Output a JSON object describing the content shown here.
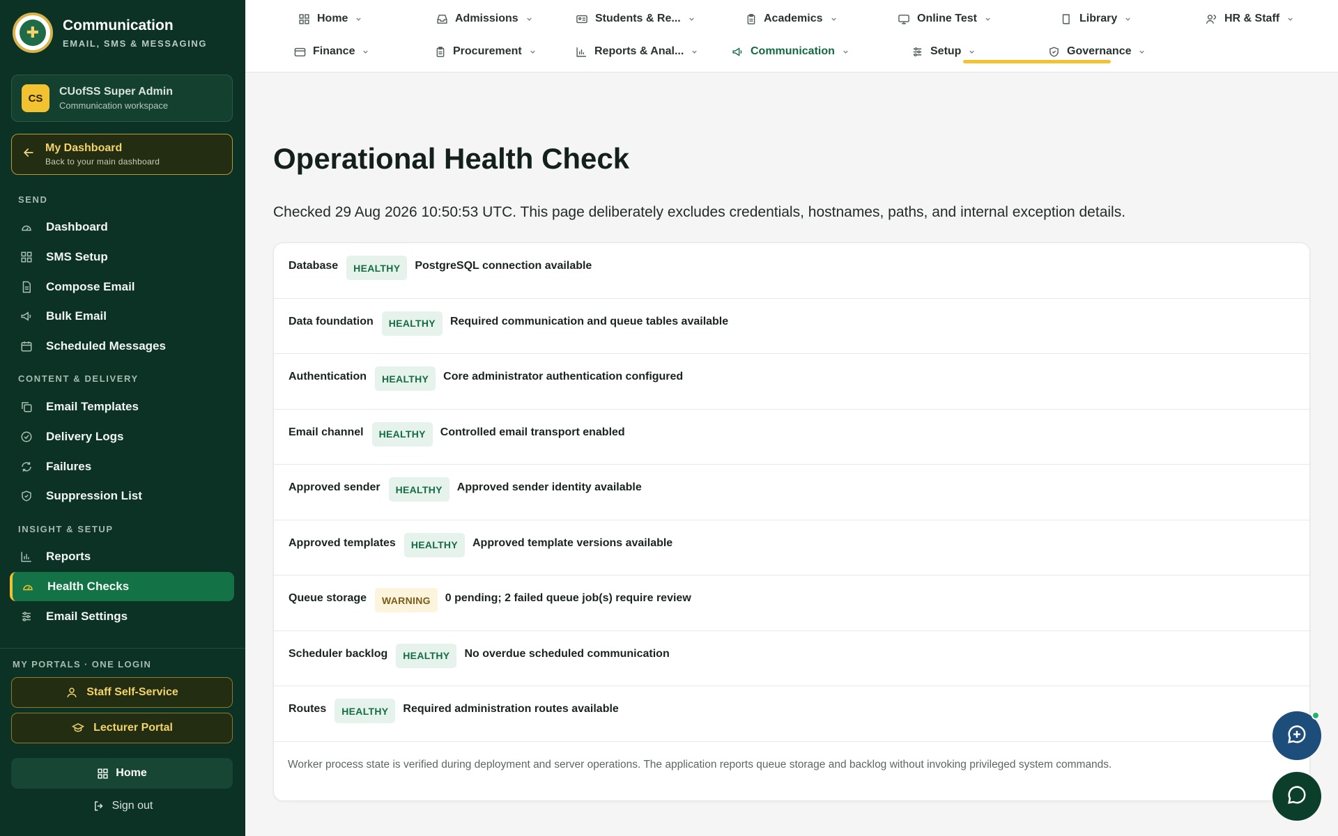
{
  "brand": {
    "title": "Communication",
    "subtitle": "EMAIL, SMS & MESSAGING"
  },
  "user": {
    "initials": "CS",
    "name": "CUofSS Super Admin",
    "workspace": "Communication workspace"
  },
  "dashboard_link": {
    "title": "My Dashboard",
    "subtitle": "Back to your main dashboard"
  },
  "sidebar": {
    "sections": [
      {
        "label": "SEND",
        "items": [
          "Dashboard",
          "SMS Setup",
          "Compose Email",
          "Bulk Email",
          "Scheduled Messages"
        ]
      },
      {
        "label": "CONTENT & DELIVERY",
        "items": [
          "Email Templates",
          "Delivery Logs",
          "Failures",
          "Suppression List"
        ]
      },
      {
        "label": "INSIGHT & SETUP",
        "items": [
          "Reports",
          "Health Checks",
          "Email Settings"
        ]
      }
    ],
    "active_item": "Health Checks",
    "portals_label": "MY PORTALS · ONE LOGIN",
    "portals": [
      "Staff Self-Service",
      "Lecturer Portal"
    ],
    "home_label": "Home",
    "signout_label": "Sign out"
  },
  "topnav": {
    "row1": [
      "Home",
      "Admissions",
      "Students & Re...",
      "Academics",
      "Online Test",
      "Library",
      "HR & Staff"
    ],
    "row2": [
      "Finance",
      "Procurement",
      "Reports & Anal...",
      "Communication",
      "Setup",
      "Governance"
    ],
    "active": "Communication"
  },
  "page": {
    "title": "Operational Health Check",
    "description": "Checked 29 Aug 2026 10:50:53 UTC. This page deliberately excludes credentials, hostnames, paths, and internal exception details."
  },
  "checks": [
    {
      "name": "Database",
      "status": "HEALTHY",
      "detail": "PostgreSQL connection available"
    },
    {
      "name": "Data foundation",
      "status": "HEALTHY",
      "detail": "Required communication and queue tables available"
    },
    {
      "name": "Authentication",
      "status": "HEALTHY",
      "detail": "Core administrator authentication configured"
    },
    {
      "name": "Email channel",
      "status": "HEALTHY",
      "detail": "Controlled email transport enabled"
    },
    {
      "name": "Approved sender",
      "status": "HEALTHY",
      "detail": "Approved sender identity available"
    },
    {
      "name": "Approved templates",
      "status": "HEALTHY",
      "detail": "Approved template versions available"
    },
    {
      "name": "Queue storage",
      "status": "WARNING",
      "detail": "0 pending; 2 failed queue job(s) require review"
    },
    {
      "name": "Scheduler backlog",
      "status": "HEALTHY",
      "detail": "No overdue scheduled communication"
    },
    {
      "name": "Routes",
      "status": "HEALTHY",
      "detail": "Required administration routes available"
    }
  ],
  "footnote": "Worker process state is verified during deployment and server operations. The application reports queue storage and backlog without invoking privileged system commands.",
  "colors": {
    "sidebar_bg": "#0c3225",
    "accent_gold": "#f2c230",
    "active_green": "#137346",
    "healthy": "#156b44",
    "warning": "#7a5c14"
  }
}
